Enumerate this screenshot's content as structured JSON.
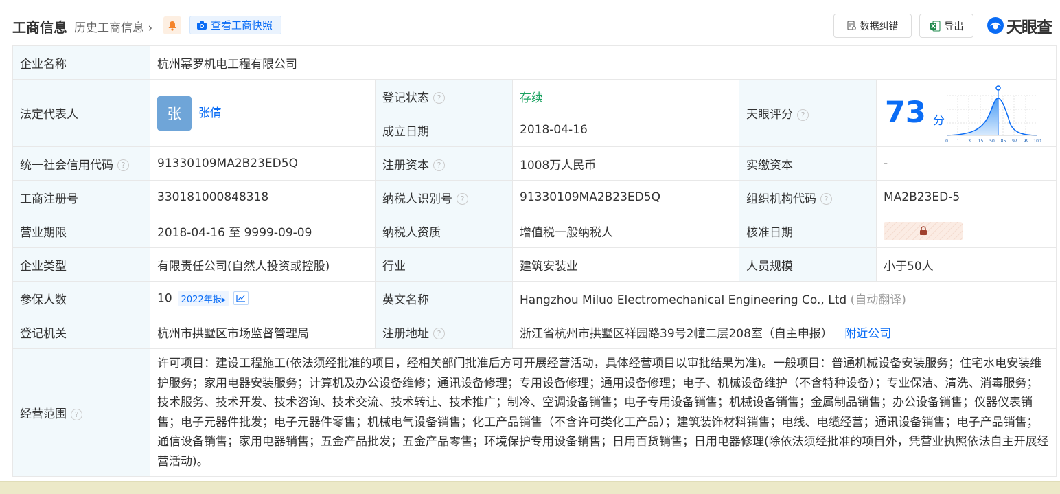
{
  "header": {
    "title": "工商信息",
    "history_link": "历史工商信息",
    "snapshot_button": "查看工商快照",
    "correction_button": "数据纠错",
    "export_button": "导出",
    "logo_text": "天眼查",
    "accent_color": "#0a6cf5"
  },
  "rows": {
    "company_name": {
      "label": "企业名称",
      "value": "杭州幂罗机电工程有限公司"
    },
    "legal_rep": {
      "label": "法定代表人",
      "avatar_char": "张",
      "name": "张倩"
    },
    "reg_status": {
      "label": "登记状态",
      "value": "存续"
    },
    "found_date": {
      "label": "成立日期",
      "value": "2018-04-16"
    },
    "tianyan_score": {
      "label": "天眼评分",
      "value": "73",
      "unit": "分",
      "axis_ticks": [
        "0",
        "1",
        "3",
        "15",
        "50",
        "85",
        "97",
        "99",
        "100"
      ]
    },
    "credit_code": {
      "label": "统一社会信用代码",
      "value": "91330109MA2B23ED5Q"
    },
    "reg_capital": {
      "label": "注册资本",
      "value": "1008万人民币"
    },
    "paid_capital": {
      "label": "实缴资本",
      "value": "-"
    },
    "reg_no": {
      "label": "工商注册号",
      "value": "330181000848318"
    },
    "taxpayer_id": {
      "label": "纳税人识别号",
      "value": "91330109MA2B23ED5Q"
    },
    "org_code": {
      "label": "组织机构代码",
      "value": "MA2B23ED-5"
    },
    "term": {
      "label": "营业期限",
      "value": "2018-04-16 至 9999-09-09"
    },
    "taxpayer_qual": {
      "label": "纳税人资质",
      "value": "增值税一般纳税人"
    },
    "approve_date": {
      "label": "核准日期"
    },
    "company_type": {
      "label": "企业类型",
      "value": "有限责任公司(自然人投资或控股)"
    },
    "industry": {
      "label": "行业",
      "value": "建筑安装业"
    },
    "staff_size": {
      "label": "人员规模",
      "value": "小于50人"
    },
    "insured": {
      "label": "参保人数",
      "value": "10",
      "report": "2022年报"
    },
    "english_name": {
      "label": "英文名称",
      "value": "Hangzhou Miluo Electromechanical Engineering Co., Ltd",
      "note": "(自动翻译)"
    },
    "reg_authority": {
      "label": "登记机关",
      "value": "杭州市拱墅区市场监督管理局"
    },
    "reg_address": {
      "label": "注册地址",
      "value": "浙江省杭州市拱墅区祥园路39号2幢二层208室（自主申报）",
      "link": "附近公司"
    },
    "scope": {
      "label": "经营范围",
      "value": "许可项目：建设工程施工(依法须经批准的项目，经相关部门批准后方可开展经营活动，具体经营项目以审批结果为准)。一般项目：普通机械设备安装服务；住宅水电安装维护服务；家用电器安装服务；计算机及办公设备维修；通讯设备修理；专用设备修理；通用设备修理；电子、机械设备维护（不含特种设备）；专业保洁、清洗、消毒服务；技术服务、技术开发、技术咨询、技术交流、技术转让、技术推广；制冷、空调设备销售；电子专用设备销售；机械设备销售；金属制品销售；办公设备销售；仪器仪表销售；电子元器件批发；电子元器件零售；机械电气设备销售；化工产品销售（不含许可类化工产品）；建筑装饰材料销售；电线、电缆经营；通讯设备销售；电子产品销售；通信设备销售；家用电器销售；五金产品批发；五金产品零售；环境保护专用设备销售；日用百货销售；日用电器修理(除依法须经批准的项目外，凭营业执照依法自主开展经营活动)。"
    }
  }
}
